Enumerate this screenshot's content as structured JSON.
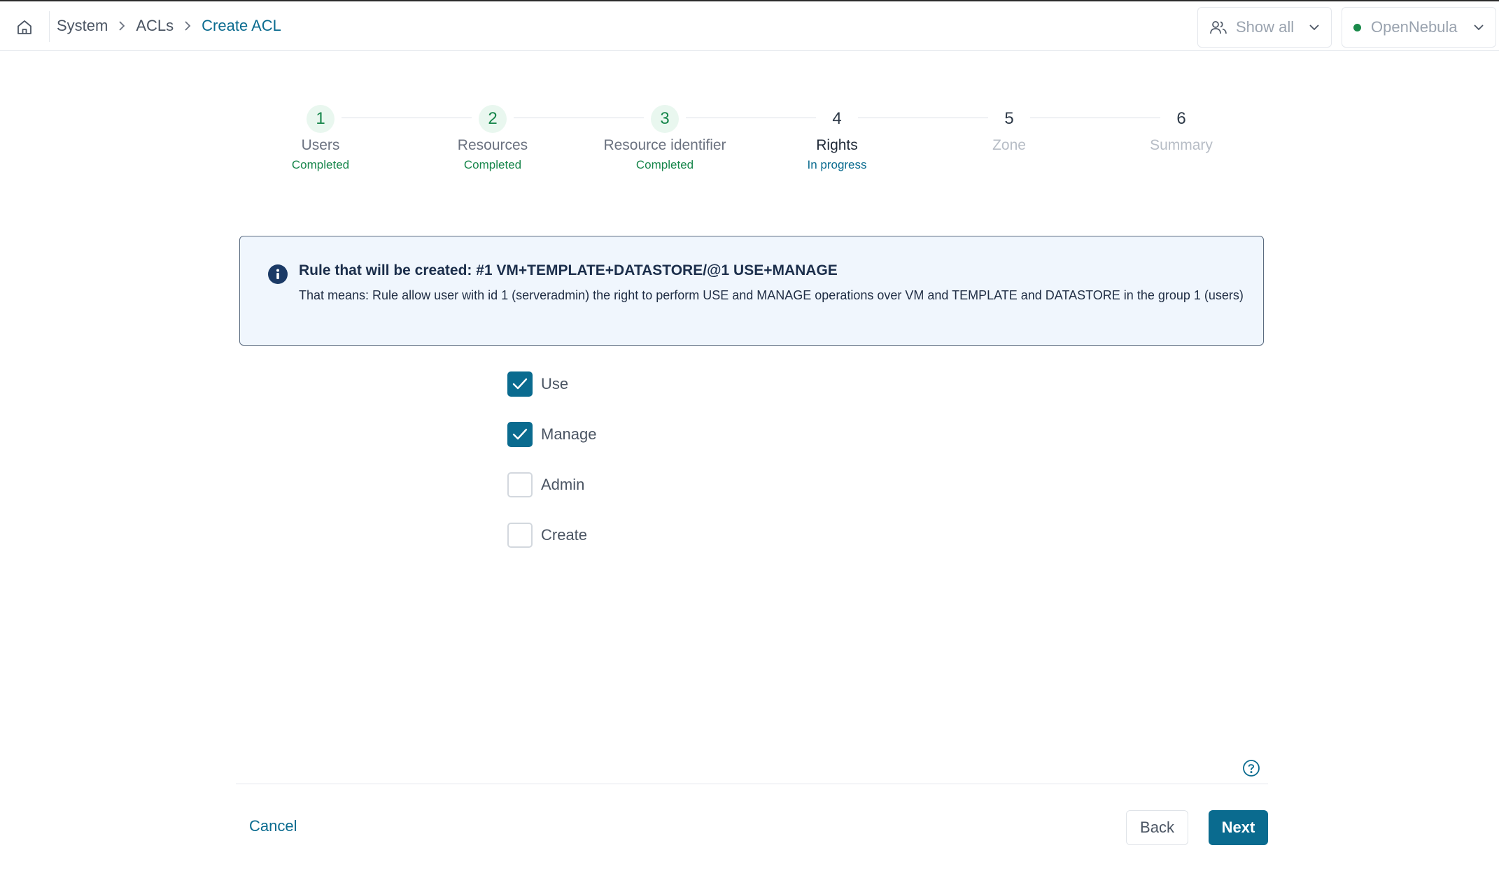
{
  "breadcrumb": {
    "items": [
      "System",
      "ACLs"
    ],
    "current": "Create ACL"
  },
  "header": {
    "group_selector": {
      "label": "Show all",
      "icon": "users-icon"
    },
    "zone_selector": {
      "label": "OpenNebula",
      "status_color": "#1a8a4a"
    }
  },
  "stepper": {
    "steps": [
      {
        "number": "1",
        "label": "Users",
        "status": "Completed",
        "state": "done"
      },
      {
        "number": "2",
        "label": "Resources",
        "status": "Completed",
        "state": "done"
      },
      {
        "number": "3",
        "label": "Resource identifier",
        "status": "Completed",
        "state": "done"
      },
      {
        "number": "4",
        "label": "Rights",
        "status": "In progress",
        "state": "active"
      },
      {
        "number": "5",
        "label": "Zone",
        "status": "",
        "state": "pending"
      },
      {
        "number": "6",
        "label": "Summary",
        "status": "",
        "state": "pending"
      }
    ]
  },
  "info": {
    "title": "Rule that will be created: #1 VM+TEMPLATE+DATASTORE/@1 USE+MANAGE",
    "body": "That means: Rule allow user with id 1 (serveradmin) the right to perform USE and MANAGE operations over VM and TEMPLATE and DATASTORE in the group 1 (users)"
  },
  "rights": [
    {
      "label": "Use",
      "checked": true
    },
    {
      "label": "Manage",
      "checked": true
    },
    {
      "label": "Admin",
      "checked": false
    },
    {
      "label": "Create",
      "checked": false
    }
  ],
  "footer": {
    "cancel_label": "Cancel",
    "back_label": "Back",
    "next_label": "Next"
  },
  "colors": {
    "accent": "#0a6b8f",
    "completed": "#17864b",
    "info_bg": "#f0f6fd"
  }
}
